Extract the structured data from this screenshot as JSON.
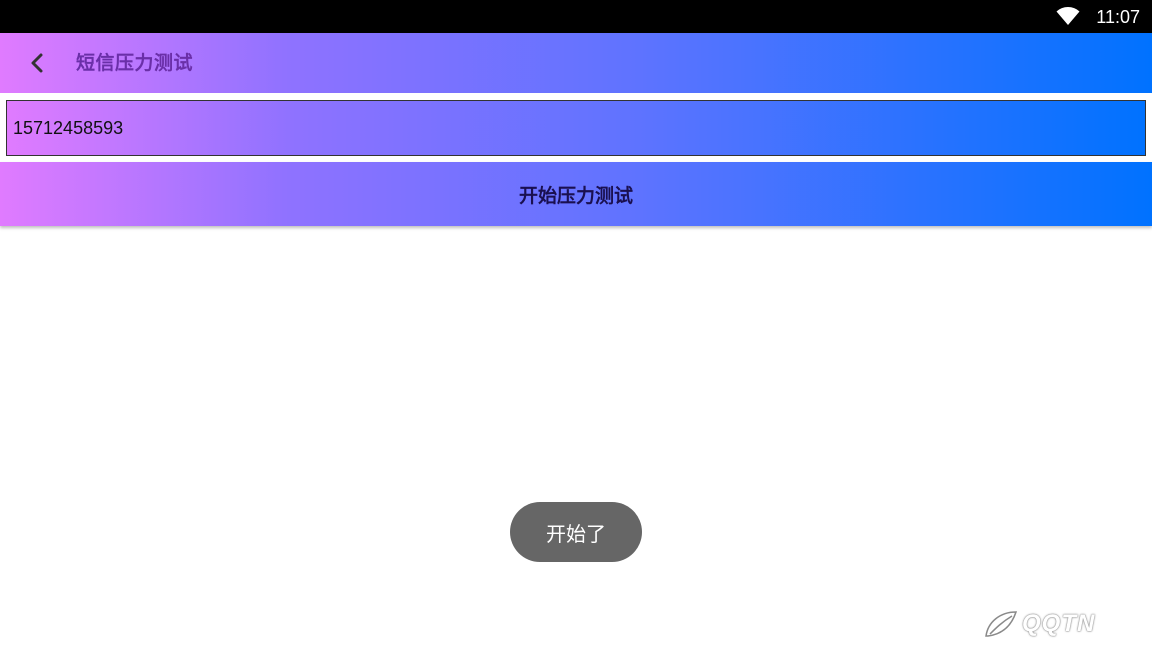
{
  "status_bar": {
    "time": "11:07",
    "wifi_icon": "wifi-icon"
  },
  "app_bar": {
    "back_icon": "chevron-left-icon",
    "title": "短信压力测试"
  },
  "form": {
    "phone_value": "15712458593",
    "start_button_label": "开始压力测试"
  },
  "toast": {
    "message": "开始了"
  },
  "colors": {
    "gradient_start": "#e07bff",
    "gradient_end": "#0072ff",
    "title_color": "#6a2fa8",
    "toast_bg": "#666666"
  }
}
